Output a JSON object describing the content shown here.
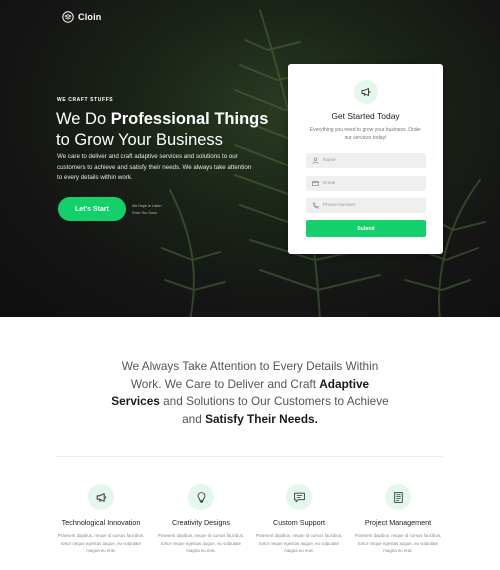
{
  "brand": {
    "name": "Cloin",
    "icon": "stack-logo-icon"
  },
  "colors": {
    "accent": "#13d06a",
    "accent_soft": "#e3f8ea",
    "hero_bg": "#141414"
  },
  "hero": {
    "kicker": "WE CRAFT STUFFS",
    "headline_pre": "We Do ",
    "headline_bold": "Professional Things",
    "headline_post": "to Grow Your Business",
    "lead": "We care to deliver and craft adaptive services and solutions to our customers to achieve and satisfy their needs. We always take attention to every details within work.",
    "cta_label": "Let's Start",
    "cta_note_line1": "We Hope to Listen",
    "cta_note_line2": "From You Soon"
  },
  "form": {
    "icon": "megaphone-icon",
    "title": "Get Started Today",
    "subtitle": "Everything you need to grow your business. Order our services today!",
    "fields": [
      {
        "icon": "user-icon",
        "placeholder": "Name",
        "value": ""
      },
      {
        "icon": "email-icon",
        "placeholder": "Email",
        "value": ""
      },
      {
        "icon": "phone-icon",
        "placeholder": "Phone Number",
        "value": ""
      }
    ],
    "submit_label": "Submit"
  },
  "statement": {
    "part1": "We Always Take Attention to Every Details Within Work. We Care to Deliver and Craft ",
    "bold1": "Adaptive Services",
    "part2": " and Solutions to Our Customers to Achieve and ",
    "bold2": "Satisfy Their Needs."
  },
  "features": [
    {
      "icon": "megaphone-icon",
      "title": "Technological Innovation",
      "text": "Praesent dapibus, neque id cursus faucibus, tortor neque egestas augue, eu vulputate magna eu erat."
    },
    {
      "icon": "lightbulb-icon",
      "title": "Creativity Designs",
      "text": "Praesent dapibus, neque id cursus faucibus, tortor neque egestas augue, eu vulputate magna eu erat."
    },
    {
      "icon": "chat-icon",
      "title": "Custom Support",
      "text": "Praesent dapibus, neque id cursus faucibus, tortor neque egestas augue, eu vulputate magna eu erat."
    },
    {
      "icon": "document-icon",
      "title": "Project Management",
      "text": "Praesent dapibus, neque id cursus faucibus, tortor neque egestas augue, eu vulputate magna eu erat."
    }
  ]
}
